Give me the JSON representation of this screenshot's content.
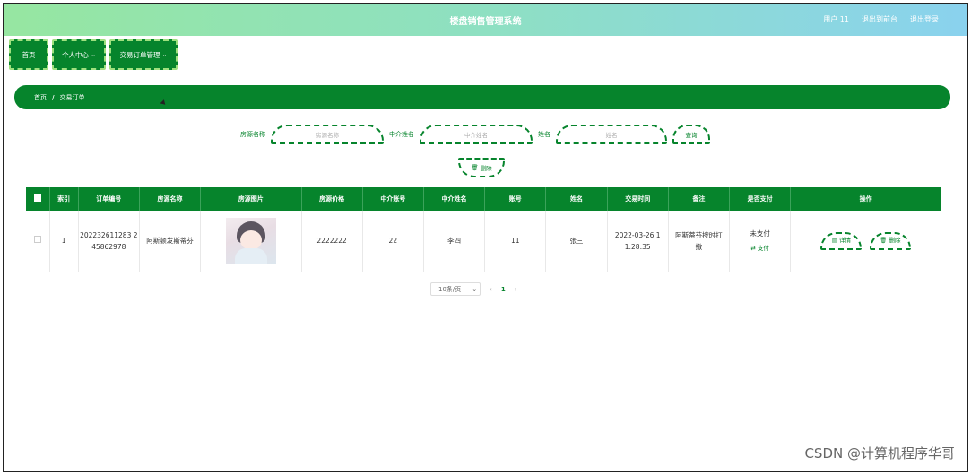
{
  "header": {
    "title": "楼盘销售管理系统",
    "user": "用户 11",
    "back_link": "退出到前台",
    "logout_link": "退出登录"
  },
  "nav": {
    "home": "首页",
    "personal": "个人中心",
    "orders": "交易订单管理"
  },
  "breadcrumb": {
    "home": "首页",
    "sep": "/",
    "current": "交易订单"
  },
  "search": {
    "house_name_label": "房源名称",
    "house_name_placeholder": "房源名称",
    "agent_name_label": "中介姓名",
    "agent_name_placeholder": "中介姓名",
    "name_label": "姓名",
    "name_placeholder": "姓名",
    "query_button": "查询",
    "delete_button": "删除"
  },
  "table": {
    "headers": [
      "索引",
      "订单编号",
      "房源名称",
      "房源图片",
      "房源价格",
      "中介账号",
      "中介姓名",
      "账号",
      "姓名",
      "交易时间",
      "备注",
      "是否支付",
      "操作"
    ],
    "rows": [
      {
        "index": "1",
        "order_no": "202232611283 245862978",
        "house_name": "阿斯顿发斯蒂芬",
        "price": "2222222",
        "agent_account": "22",
        "agent_name": "李四",
        "account": "11",
        "name": "张三",
        "time": "2022-03-26 1 1:28:35",
        "remark": "阿斯蒂芬按时打 撒",
        "paid_status": "未支付",
        "pay_link": "支付",
        "detail_button": "详情",
        "delete_button": "删除"
      }
    ]
  },
  "pager": {
    "page_size": "10条/页",
    "prev": "‹",
    "current_page": "1",
    "next": "›"
  },
  "watermark": "CSDN @计算机程序华哥"
}
